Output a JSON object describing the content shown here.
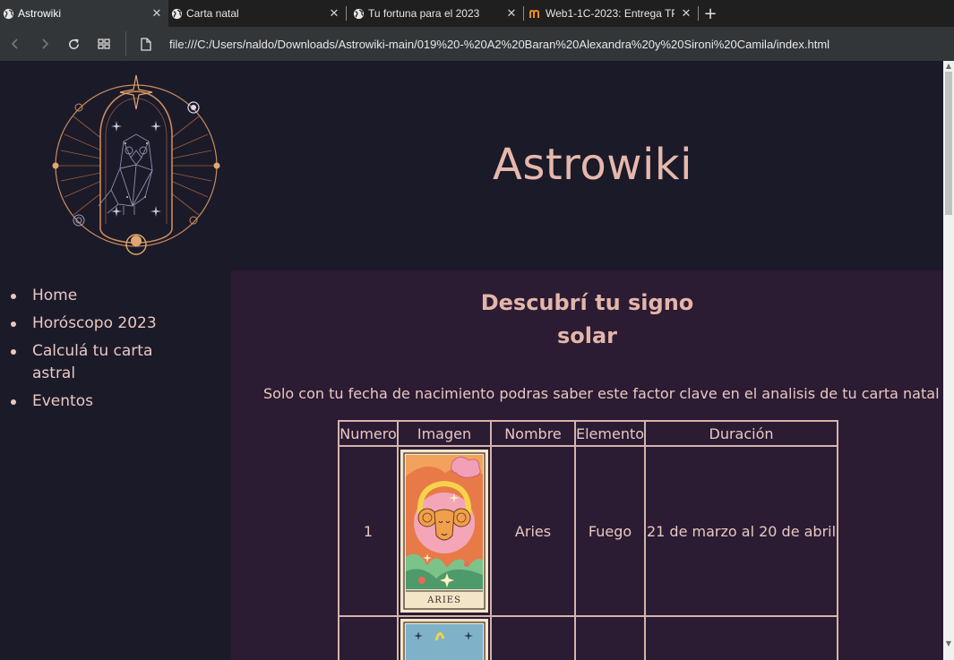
{
  "browser": {
    "tabs": [
      {
        "title": "Astrowiki",
        "active": true,
        "icon": "globe-icon"
      },
      {
        "title": "Carta natal",
        "active": false,
        "icon": "globe-icon"
      },
      {
        "title": "Tu fortuna para el 2023",
        "active": false,
        "icon": "globe-icon"
      },
      {
        "title": "Web1-1C-2023: Entrega TP",
        "active": false,
        "icon": "moodle-icon"
      }
    ],
    "address": "file:///C:/Users/naldo/Downloads/Astrowiki-main/019%20-%20A2%20Baran%20Alexandra%20y%20Sironi%20Camila/index.html"
  },
  "site": {
    "title": "Astrowiki"
  },
  "nav": {
    "items": [
      "Home",
      "Horóscopo 2023",
      "Calculá tu carta astral",
      "Eventos"
    ]
  },
  "main": {
    "heading_line1": "Descubrí tu signo",
    "heading_line2": "solar",
    "lead": "Solo con tu fecha de nacimiento podras saber este factor clave en el analisis de tu carta natal",
    "table": {
      "headers": [
        "Numero",
        "Imagen",
        "Nombre",
        "Elemento",
        "Duración"
      ],
      "rows": [
        {
          "numero": "1",
          "card_caption": "ARIES",
          "nombre": "Aries",
          "elemento": "Fuego",
          "duracion": "21 de marzo al 20 de abril"
        }
      ]
    }
  },
  "colors": {
    "page_bg": "#1b1a29",
    "main_bg": "#2b1b33",
    "accent": "#e3b6a9",
    "text": "#e8c8c0"
  }
}
